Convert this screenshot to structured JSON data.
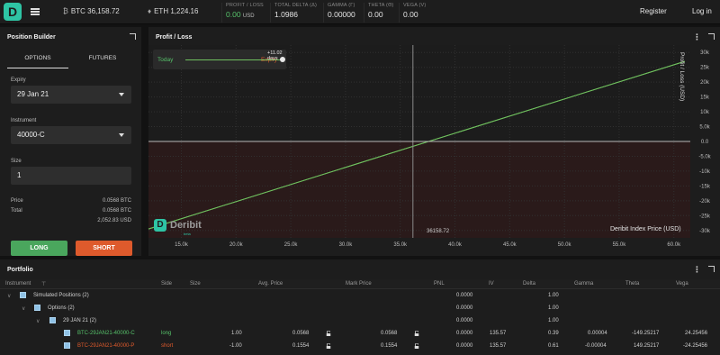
{
  "topbar": {
    "btc_symbol": "₿",
    "btc_label": "BTC 36,158.72",
    "eth_symbol": "♦",
    "eth_label": "ETH 1,224.16",
    "stats": [
      {
        "label": "PROFIT / LOSS",
        "value": "0.00",
        "unit": "USD"
      },
      {
        "label": "TOTAL DELTA (Δ)",
        "value": "1.0986",
        "unit": ""
      },
      {
        "label": "GAMMA (Γ)",
        "value": "0.00000",
        "unit": ""
      },
      {
        "label": "THETA (Θ)",
        "value": "0.00",
        "unit": ""
      },
      {
        "label": "VEGA (V)",
        "value": "0.00",
        "unit": ""
      }
    ],
    "register": "Register",
    "login": "Log in"
  },
  "position_builder": {
    "title": "Position Builder",
    "tabs": [
      "OPTIONS",
      "FUTURES"
    ],
    "expiry_label": "Expiry",
    "expiry_value": "29 Jan 21",
    "instrument_label": "Instrument",
    "instrument_value": "40000-C",
    "size_label": "Size",
    "size_value": "1",
    "price_label": "Price",
    "price_value": "0.0568 BTC",
    "total_label": "Total",
    "total_btc": "0.0568 BTC",
    "total_usd": "2,052.83 USD",
    "long_label": "LONG",
    "short_label": "SHORT"
  },
  "pnl_panel": {
    "title": "Profit / Loss",
    "slider_days": "+11.02 days",
    "legend_today": "Today",
    "legend_expiry": "Expiry",
    "crosshair_label": "36158.72",
    "xlabel": "Deribit Index Price  (USD)",
    "ylabel": "Profit / Loss  (USD)",
    "watermark": "Deribit",
    "watermark_sub": "beta"
  },
  "chart_data": {
    "type": "line",
    "series": [
      {
        "name": "Today",
        "x": [
          12000,
          61000
        ],
        "y": [
          -29500,
          27000
        ]
      },
      {
        "name": "Expiry",
        "x": [
          12000,
          61000
        ],
        "y": [
          -29500,
          27000
        ]
      }
    ],
    "xticks": [
      "15.0k",
      "20.0k",
      "25.0k",
      "30.0k",
      "35.0k",
      "40.0k",
      "45.0k",
      "50.0k",
      "55.0k",
      "60.0k"
    ],
    "xtick_values": [
      15000,
      20000,
      25000,
      30000,
      35000,
      40000,
      45000,
      50000,
      55000,
      60000
    ],
    "yticks": [
      "30k",
      "25k",
      "20k",
      "15k",
      "10k",
      "5.0k",
      "0.0",
      "-5.0k",
      "-10k",
      "-15k",
      "-20k",
      "-25k",
      "-30k"
    ],
    "ytick_values": [
      30000,
      25000,
      20000,
      15000,
      10000,
      5000,
      0,
      -5000,
      -10000,
      -15000,
      -20000,
      -25000,
      -30000
    ],
    "xlim": [
      12000,
      61500
    ],
    "ylim": [
      -32500,
      32500
    ],
    "crosshair_x": 36158.72,
    "xlabel": "Deribit Index Price  (USD)",
    "ylabel": "Profit / Loss  (USD)",
    "colors": {
      "line": "#6fbf5e",
      "loss_area": "#2a1a1a",
      "profit_area": "#1c1c1c"
    }
  },
  "portfolio": {
    "title": "Portfolio",
    "headers": [
      "Instrument",
      "Side",
      "Size",
      "Avg. Price",
      "Mark Price",
      "PNL",
      "IV",
      "Delta",
      "Gamma",
      "Theta",
      "Vega"
    ],
    "sort_icon": "⊤",
    "rows": [
      {
        "name": "Simulated Positions (2)",
        "pnl": "0.0000",
        "delta": "1.00"
      },
      {
        "name": "Options (2)",
        "pnl": "0.0000",
        "delta": "1.00"
      },
      {
        "name": "29 JAN 21 (2)",
        "pnl": "0.0000",
        "delta": "1.00"
      },
      {
        "name": "BTC-29JAN21-40000-C",
        "side": "long",
        "size": "1.00",
        "avg": "0.0568",
        "mark": "0.0568",
        "pnl": "0.0000",
        "iv": "135.57",
        "delta": "0.39",
        "gamma": "0.00004",
        "theta": "-149.25217",
        "vega": "24.25456"
      },
      {
        "name": "BTC-29JAN21-40000-P",
        "side": "short",
        "size": "-1.00",
        "avg": "0.1554",
        "mark": "0.1554",
        "pnl": "0.0000",
        "iv": "135.57",
        "delta": "0.61",
        "gamma": "-0.00004",
        "theta": "149.25217",
        "vega": "-24.25456"
      }
    ]
  }
}
